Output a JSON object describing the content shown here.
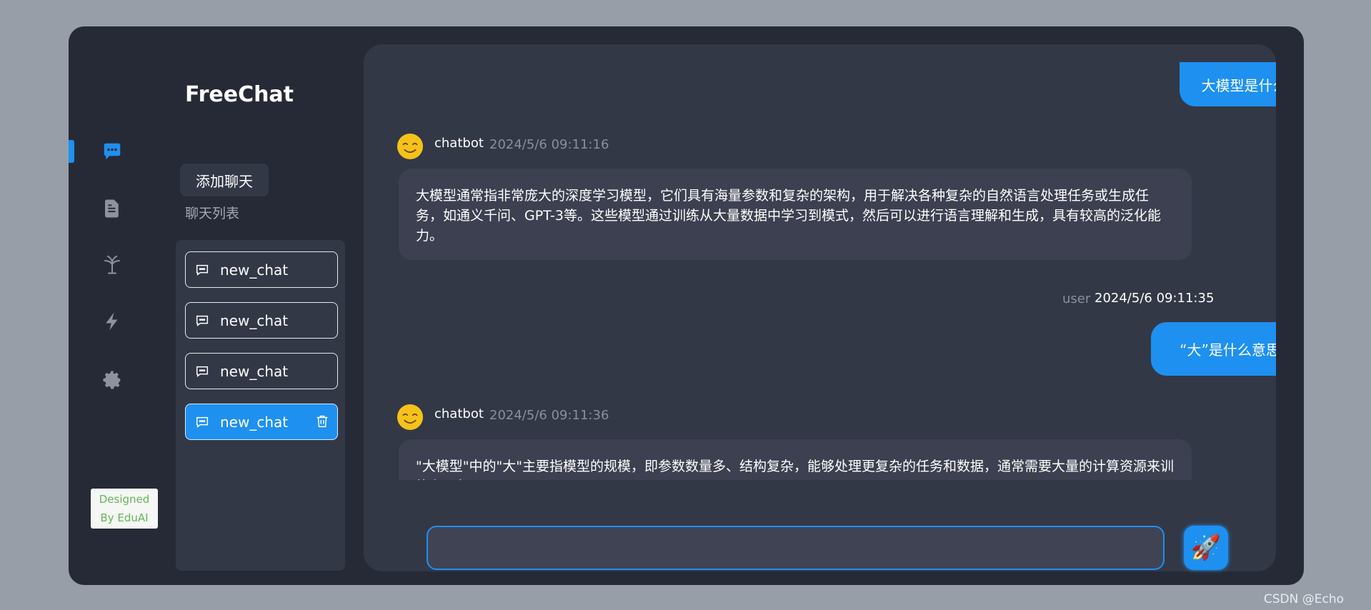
{
  "brand": {
    "title": "FreeChat"
  },
  "rail": {
    "icons": [
      "chat-bubble-icon",
      "document-icon",
      "plant-icon",
      "lightning-icon",
      "gear-icon"
    ],
    "accent": "#1e90f0"
  },
  "badge": {
    "line1": "Designed",
    "line2": "By EduAI"
  },
  "sidebar": {
    "add_chat_label": "添加聊天",
    "list_title": "聊天列表",
    "chats": [
      {
        "label": "new_chat",
        "active": false
      },
      {
        "label": "new_chat",
        "active": false
      },
      {
        "label": "new_chat",
        "active": false
      },
      {
        "label": "new_chat",
        "active": true
      }
    ]
  },
  "messages": [
    {
      "role": "user",
      "text": "大模型是什么"
    },
    {
      "role": "bot",
      "name": "chatbot",
      "time": "2024/5/6 09:11:16",
      "text": "大模型通常指非常庞大的深度学习模型，它们具有海量参数和复杂的架构，用于解决各种复杂的自然语言处理任务或生成任务，如通义千问、GPT-3等。这些模型通过训练从大量数据中学习到模式，然后可以进行语言理解和生成，具有较高的泛化能力。"
    },
    {
      "role": "user",
      "name": "user",
      "time": "2024/5/6 09:11:35",
      "text": "“大”是什么意思"
    },
    {
      "role": "bot",
      "name": "chatbot",
      "time": "2024/5/6 09:11:36",
      "text": "\"大模型\"中的\"大\"主要指模型的规模，即参数数量多、结构复杂，能够处理更复杂的任务和数据，通常需要大量的计算资源来训练和运行。"
    }
  ],
  "input": {
    "value": "",
    "placeholder": ""
  },
  "watermark": "CSDN @Echo"
}
